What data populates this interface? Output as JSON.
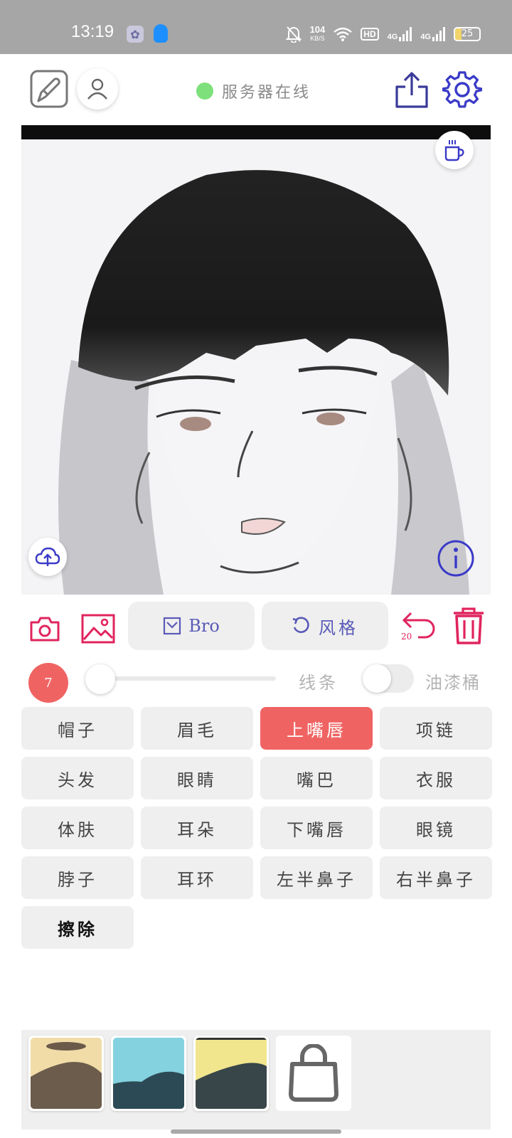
{
  "status_bar": {
    "time": "13:19",
    "speed_value": "104",
    "speed_unit": "KB/S",
    "hd_label": "HD",
    "net_label_1": "4G",
    "net_label_2": "4G",
    "battery_level": "25"
  },
  "header": {
    "server_status": "服务器在线",
    "server_status_color": "#7ee07a"
  },
  "tools": {
    "bro_label": "Bro",
    "style_label": "风格",
    "undo_count": "20"
  },
  "brush": {
    "size": "7",
    "slider_fraction": 0.0,
    "line_label": "线条",
    "bucket_label": "油漆桶",
    "bucket_toggle_on": false
  },
  "parts": [
    {
      "label": "帽子",
      "selected": false
    },
    {
      "label": "眉毛",
      "selected": false
    },
    {
      "label": "上嘴唇",
      "selected": true
    },
    {
      "label": "项链",
      "selected": false
    },
    {
      "label": "头发",
      "selected": false
    },
    {
      "label": "眼睛",
      "selected": false
    },
    {
      "label": "嘴巴",
      "selected": false
    },
    {
      "label": "衣服",
      "selected": false
    },
    {
      "label": "体肤",
      "selected": false
    },
    {
      "label": "耳朵",
      "selected": false
    },
    {
      "label": "下嘴唇",
      "selected": false
    },
    {
      "label": "眼镜",
      "selected": false
    },
    {
      "label": "脖子",
      "selected": false
    },
    {
      "label": "耳环",
      "selected": false
    },
    {
      "label": "左半鼻子",
      "selected": false
    },
    {
      "label": "右半鼻子",
      "selected": false
    },
    {
      "label": "擦除",
      "selected": false
    }
  ],
  "palette": {
    "swatches": [
      "sand-hills",
      "cyan-hills",
      "yellow-hills"
    ],
    "store_icon": "bag-icon"
  },
  "colors": {
    "accent_red": "#ef6463",
    "icon_pink": "#e0245e",
    "icon_blue": "#4a4ab0"
  }
}
